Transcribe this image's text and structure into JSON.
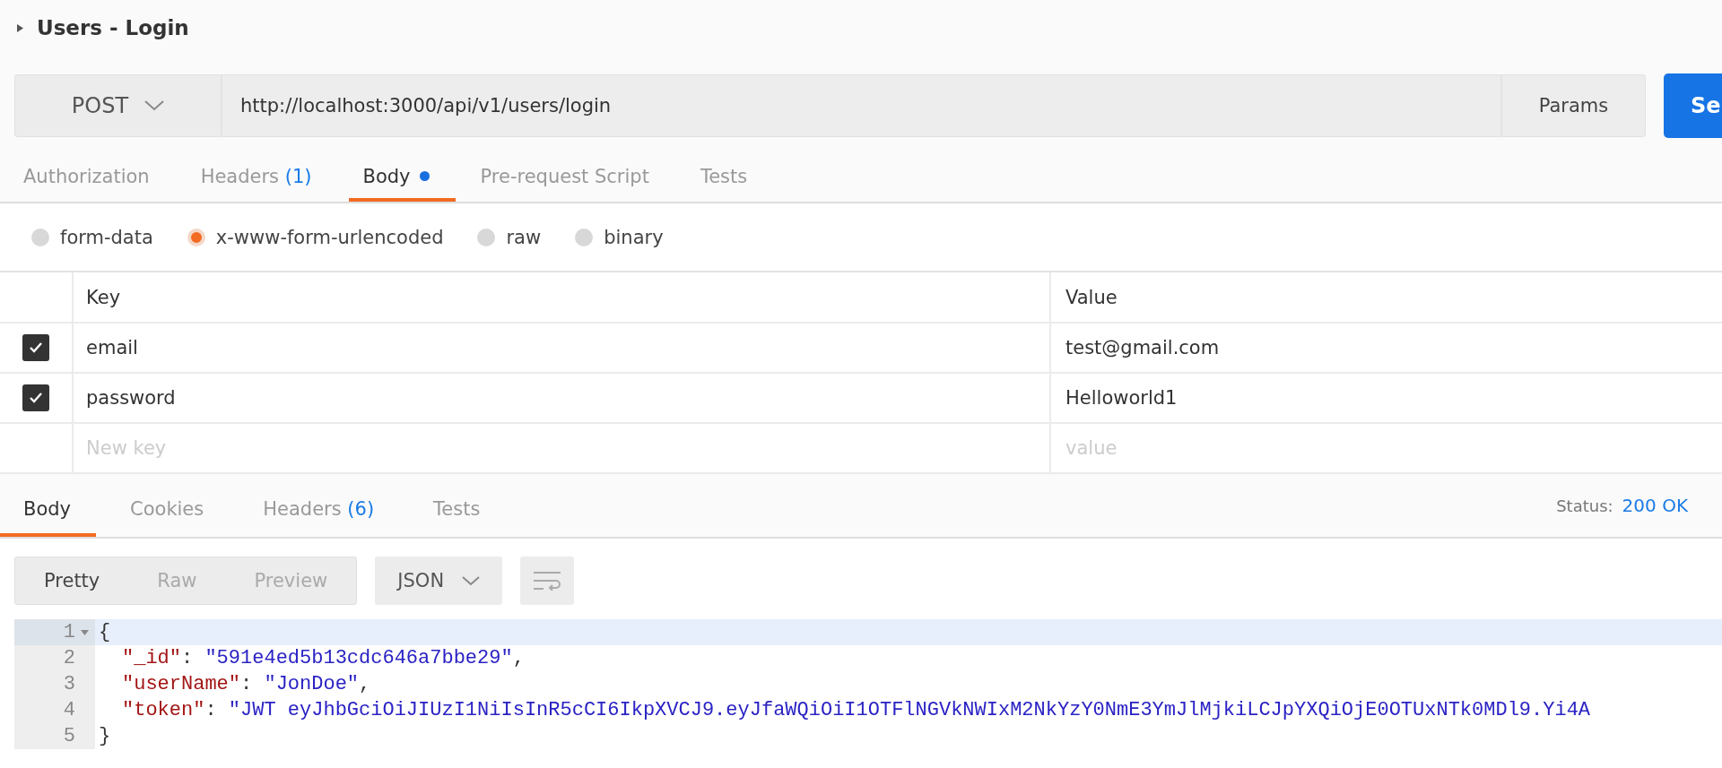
{
  "request_title": "Users - Login",
  "method": "POST",
  "url": "http://localhost:3000/api/v1/users/login",
  "params_label": "Params",
  "send_label": "Se",
  "request_tabs": [
    {
      "label": "Authorization",
      "selected": false,
      "modified": false
    },
    {
      "label": "Headers",
      "count": "(1)",
      "selected": false,
      "modified": false
    },
    {
      "label": "Body",
      "selected": true,
      "modified": true
    },
    {
      "label": "Pre-request Script",
      "selected": false,
      "modified": false
    },
    {
      "label": "Tests",
      "selected": false,
      "modified": false
    }
  ],
  "body_types": [
    {
      "label": "form-data",
      "selected": false
    },
    {
      "label": "x-www-form-urlencoded",
      "selected": true
    },
    {
      "label": "raw",
      "selected": false
    },
    {
      "label": "binary",
      "selected": false
    }
  ],
  "params_table": {
    "columns": [
      "Key",
      "Value"
    ],
    "rows": [
      {
        "checked": true,
        "key": "email",
        "value": "test@gmail.com"
      },
      {
        "checked": true,
        "key": "password",
        "value": "Helloworld1"
      }
    ],
    "new_row": {
      "key_placeholder": "New key",
      "value_placeholder": "value"
    }
  },
  "response_tabs": [
    {
      "label": "Body",
      "selected": true
    },
    {
      "label": "Cookies",
      "selected": false
    },
    {
      "label": "Headers",
      "count": "(6)",
      "selected": false
    },
    {
      "label": "Tests",
      "selected": false
    }
  ],
  "status": {
    "label": "Status:",
    "value": "200 OK"
  },
  "view_modes": [
    {
      "label": "Pretty",
      "selected": true
    },
    {
      "label": "Raw",
      "selected": false
    },
    {
      "label": "Preview",
      "selected": false
    }
  ],
  "format": "JSON",
  "code_lines": [
    {
      "number": "1",
      "kind": "brace",
      "foldable": true,
      "active": true,
      "tokens": [
        {
          "kind": "punct",
          "text": "{"
        }
      ]
    },
    {
      "number": "2",
      "kind": "member",
      "foldable": false,
      "active": false,
      "tokens": [
        {
          "kind": "key",
          "text": "\"_id\""
        },
        {
          "kind": "punct",
          "text": ": "
        },
        {
          "kind": "string",
          "text": "\"591e4ed5b13cdc646a7bbe29\""
        },
        {
          "kind": "punct",
          "text": ","
        }
      ]
    },
    {
      "number": "3",
      "kind": "member",
      "foldable": false,
      "active": false,
      "tokens": [
        {
          "kind": "key",
          "text": "\"userName\""
        },
        {
          "kind": "punct",
          "text": ": "
        },
        {
          "kind": "string",
          "text": "\"JonDoe\""
        },
        {
          "kind": "punct",
          "text": ","
        }
      ]
    },
    {
      "number": "4",
      "kind": "member",
      "foldable": false,
      "active": false,
      "tokens": [
        {
          "kind": "key",
          "text": "\"token\""
        },
        {
          "kind": "punct",
          "text": ": "
        },
        {
          "kind": "string",
          "text": "\"JWT eyJhbGciOiJIUzI1NiIsInR5cCI6IkpXVCJ9.eyJfaWQiOiI1OTFlNGVkNWIxM2NkYzY0NmE3YmJlMjkiLCJpYXQiOjE0OTUxNTk0MDl9.Yi4A"
        }
      ]
    },
    {
      "number": "5",
      "kind": "brace",
      "foldable": false,
      "active": false,
      "tokens": [
        {
          "kind": "punct",
          "text": "}"
        }
      ]
    }
  ]
}
